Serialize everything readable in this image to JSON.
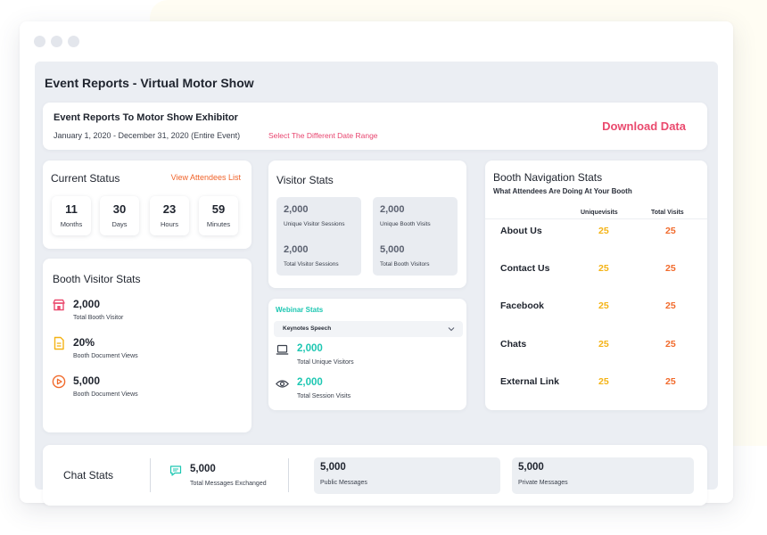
{
  "page_title": "Event Reports - Virtual Motor Show",
  "header": {
    "title": "Event Reports To Motor Show Exhibitor",
    "date_range": "January 1, 2020 - December 31, 2020 (Entire Event)",
    "select_range_label": "Select The Different Date Range",
    "download_label": "Download Data"
  },
  "current_status": {
    "title": "Current Status",
    "link_label": "View Attendees List",
    "timer": [
      {
        "value": "11",
        "label": "Months"
      },
      {
        "value": "30",
        "label": "Days"
      },
      {
        "value": "23",
        "label": "Hours"
      },
      {
        "value": "59",
        "label": "Minutes"
      }
    ]
  },
  "booth_visitor_stats": {
    "title": "Booth Visitor Stats",
    "items": [
      {
        "value": "2,000",
        "label": "Total Booth Visitor",
        "icon": "booth-icon"
      },
      {
        "value": "20%",
        "label": "Booth Document Views",
        "icon": "document-icon"
      },
      {
        "value": "5,000",
        "label": "Booth Document Views",
        "icon": "play-icon"
      }
    ]
  },
  "visitor_stats": {
    "title": "Visitor Stats",
    "items": [
      {
        "value": "2,000",
        "label": "Unique Visitor Sessions"
      },
      {
        "value": "2,000",
        "label": "Unique Booth Visits"
      },
      {
        "value": "2,000",
        "label": "Total Visitor Sessions"
      },
      {
        "value": "5,000",
        "label": "Total Booth Visitors"
      }
    ]
  },
  "webinar_stats": {
    "title": "Webinar Stats",
    "selected_option": "Keynotes Speech",
    "items": [
      {
        "value": "2,000",
        "label": "Total Unique Visitors",
        "icon": "laptop-icon"
      },
      {
        "value": "2,000",
        "label": "Total Session Visits",
        "icon": "eye-icon"
      }
    ]
  },
  "booth_navigation": {
    "title": "Booth Navigation Stats",
    "subtitle": "What Attendees Are Doing At Your Booth",
    "col_unique": "Uniquevisits",
    "col_total": "Total Visits",
    "rows": [
      {
        "label": "About Us",
        "unique": "25",
        "total": "25"
      },
      {
        "label": "Contact Us",
        "unique": "25",
        "total": "25"
      },
      {
        "label": "Facebook",
        "unique": "25",
        "total": "25"
      },
      {
        "label": "Chats",
        "unique": "25",
        "total": "25"
      },
      {
        "label": "External Link",
        "unique": "25",
        "total": "25"
      }
    ]
  },
  "chat_stats": {
    "title": "Chat Stats",
    "items": [
      {
        "value": "5,000",
        "label": "Total Messages Exchanged",
        "icon": "chat-bubble-icon"
      },
      {
        "value": "5,000",
        "label": "Public Messages"
      },
      {
        "value": "5,000",
        "label": "Private Messages"
      }
    ]
  },
  "colors": {
    "accent_pink": "#ea4a6e",
    "accent_orange": "#f16a2b",
    "accent_yellow": "#f4b315",
    "accent_teal": "#1dc7b2"
  }
}
